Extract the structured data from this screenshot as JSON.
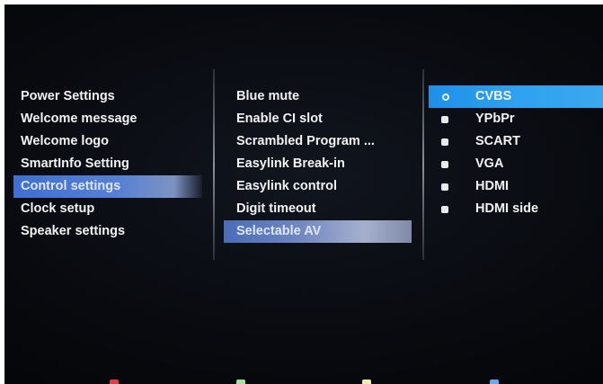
{
  "menu_main": {
    "items": [
      {
        "label": "Power Settings"
      },
      {
        "label": "Welcome message"
      },
      {
        "label": "Welcome logo"
      },
      {
        "label": "SmartInfo Setting"
      },
      {
        "label": "Control settings"
      },
      {
        "label": "Clock setup"
      },
      {
        "label": "Speaker settings"
      }
    ],
    "selected": "Control settings"
  },
  "menu_sub": {
    "items": [
      {
        "label": "Blue mute"
      },
      {
        "label": "Enable CI slot"
      },
      {
        "label": "Scrambled Program ..."
      },
      {
        "label": "Easylink Break-in"
      },
      {
        "label": "Easylink control"
      },
      {
        "label": "Digit timeout"
      },
      {
        "label": "Selectable AV"
      }
    ],
    "selected": "Selectable AV"
  },
  "menu_options": {
    "items": [
      {
        "label": "CVBS"
      },
      {
        "label": "YPbPr"
      },
      {
        "label": "SCART"
      },
      {
        "label": "VGA"
      },
      {
        "label": "HDMI"
      },
      {
        "label": "HDMI side"
      }
    ],
    "selected": "CVBS"
  },
  "color_keys": {
    "red": "#e0404a",
    "green": "#a8e0a0",
    "yellow": "#f2ecb0",
    "blue": "#6aa8f0"
  }
}
